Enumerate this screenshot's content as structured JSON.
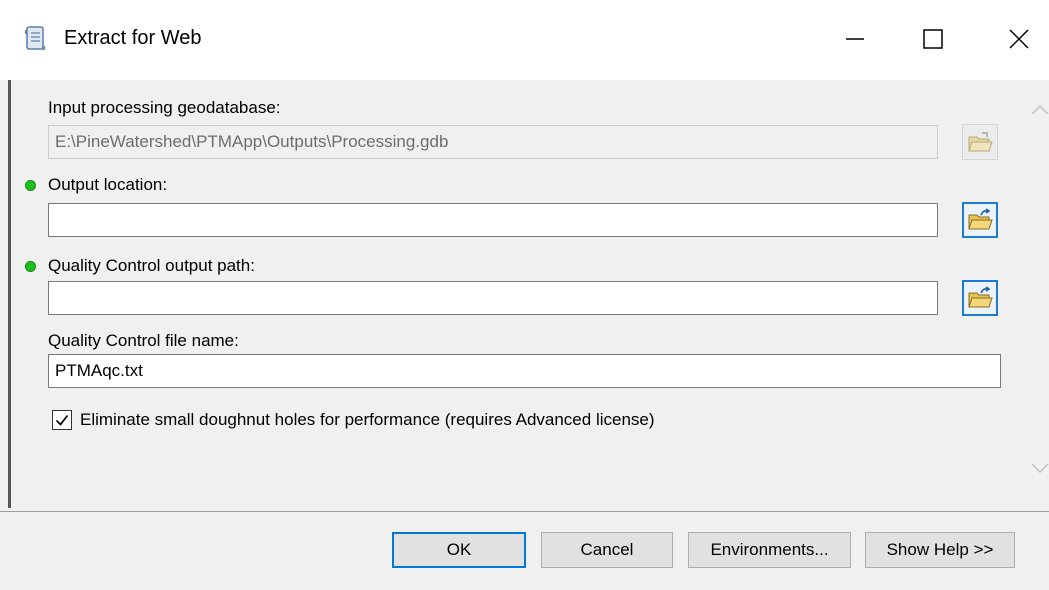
{
  "window": {
    "title": "Extract for Web",
    "icons": {
      "app": "script-tool-icon",
      "minimize": "minimize-icon",
      "maximize": "maximize-icon",
      "close": "close-icon"
    }
  },
  "form": {
    "input_gdb": {
      "label": "Input processing geodatabase:",
      "value": "E:\\PineWatershed\\PTMApp\\Outputs\\Processing.gdb",
      "enabled": false,
      "browse_icon": "open-folder-icon"
    },
    "output_location": {
      "label": "Output location:",
      "value": "",
      "required_indicator": "green-dot-icon",
      "browse_icon": "open-folder-icon"
    },
    "qc_output_path": {
      "label": "Quality Control output path:",
      "value": "",
      "required_indicator": "green-dot-icon",
      "browse_icon": "open-folder-icon"
    },
    "qc_file_name": {
      "label": "Quality Control file name:",
      "value": "PTMAqc.txt"
    },
    "eliminate_holes": {
      "label": "Eliminate small doughnut holes for performance (requires Advanced license)",
      "checked": true
    }
  },
  "buttons": {
    "ok": "OK",
    "cancel": "Cancel",
    "environments": "Environments...",
    "show_help": "Show Help >>"
  },
  "colors": {
    "required_dot": "#1fbf1f",
    "focus_border": "#0078d7",
    "folder": "#e8c155"
  }
}
